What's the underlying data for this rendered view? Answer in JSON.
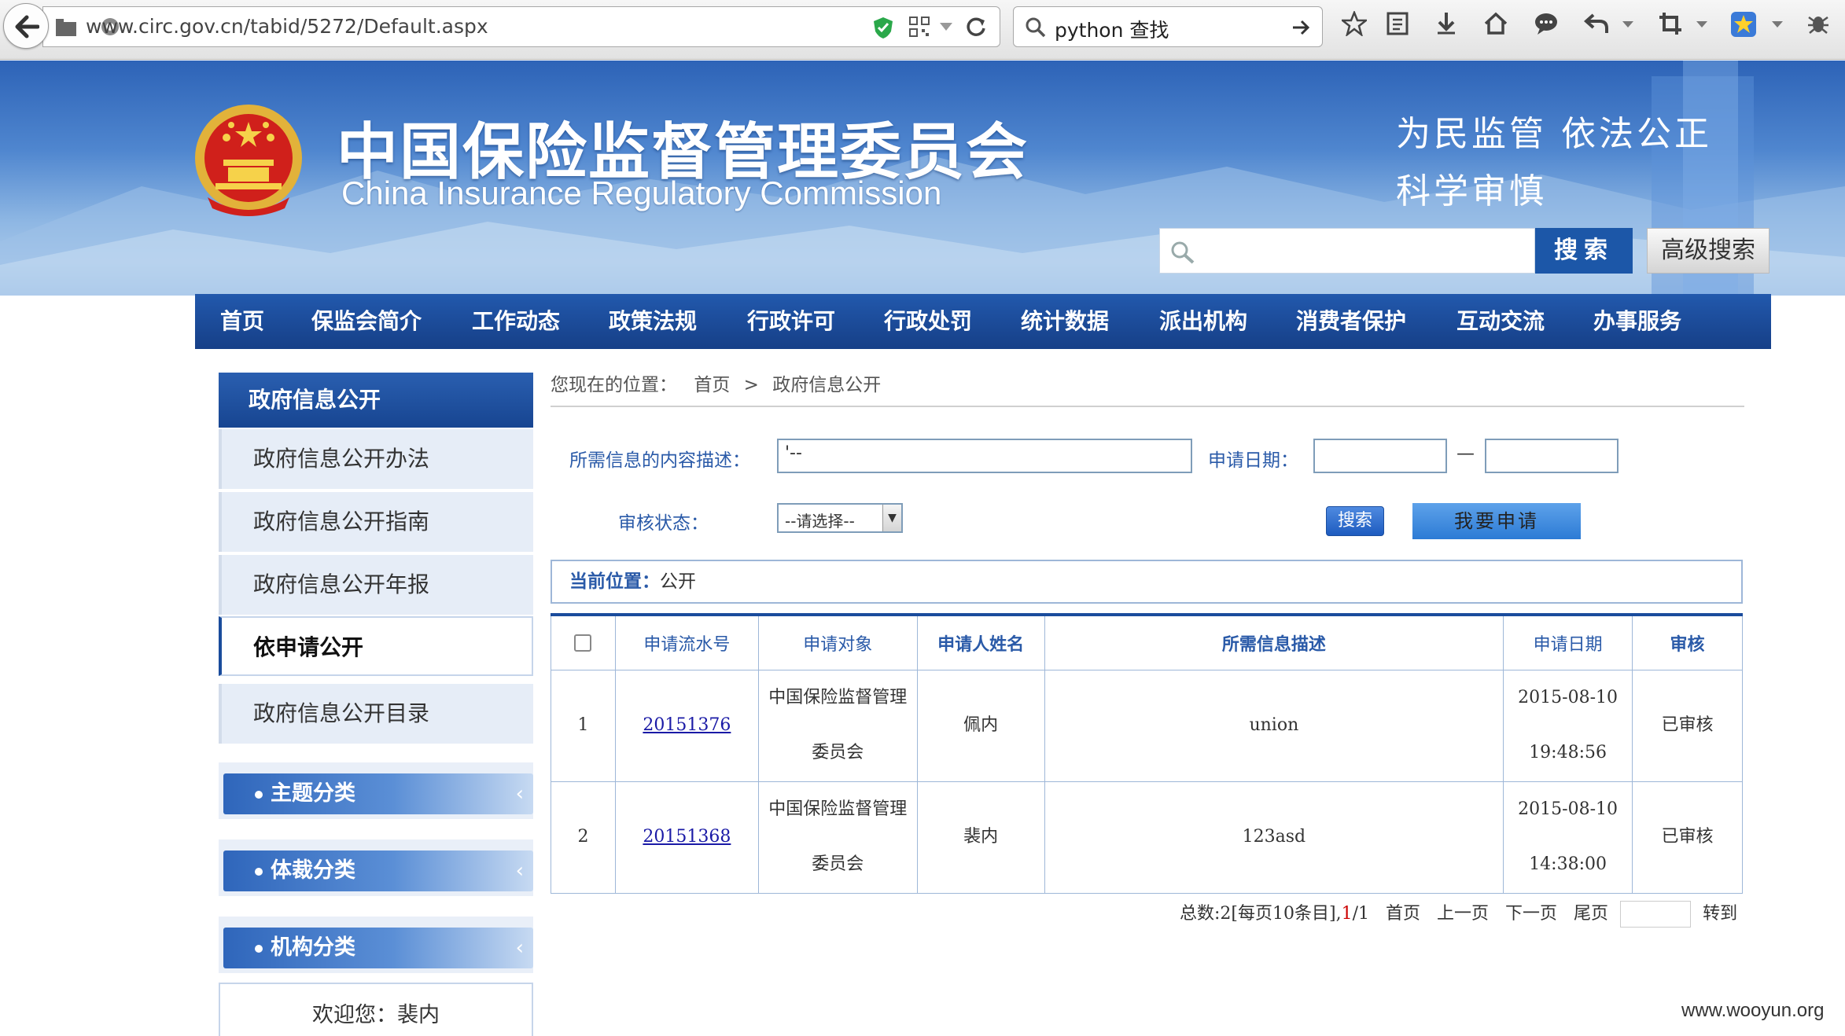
{
  "browser": {
    "url": "www.circ.gov.cn/tabid/5272/Default.aspx",
    "search_query": "python 查找"
  },
  "header": {
    "title": "中国保险监督管理委员会",
    "subtitle": "China Insurance Regulatory Commission",
    "slogan_line1": "为民监管   依法公正",
    "slogan_line2": "科学审慎",
    "search_button": "搜索",
    "advanced_search_button": "高级搜索"
  },
  "nav": {
    "items": [
      "首页",
      "保监会简介",
      "工作动态",
      "政策法规",
      "行政许可",
      "行政处罚",
      "统计数据",
      "派出机构",
      "消费者保护",
      "互动交流",
      "办事服务"
    ]
  },
  "sidebar": {
    "heading": "政府信息公开",
    "items": [
      "政府信息公开办法",
      "政府信息公开指南",
      "政府信息公开年报",
      "依申请公开",
      "政府信息公开目录"
    ],
    "active_index": 3,
    "categories": [
      "主题分类",
      "体裁分类",
      "机构分类"
    ],
    "welcome": "欢迎您：裴内"
  },
  "breadcrumb": {
    "prefix": "您现在的位置：",
    "home": "首页",
    "separator": ">",
    "current": "政府信息公开"
  },
  "form": {
    "desc_label": "所需信息的内容描述：",
    "desc_value": "'--",
    "date_label": "申请日期：",
    "date_sep": "—",
    "status_label": "审核状态：",
    "status_value": "--请选择--",
    "search_button": "搜索",
    "apply_button": "我要申请"
  },
  "current_position": {
    "label": "当前位置：",
    "value": "公开"
  },
  "table": {
    "headers": [
      "申请流水号",
      "申请对象",
      "申请人姓名",
      "所需信息描述",
      "申请日期",
      "审核"
    ],
    "rows": [
      {
        "no": "1",
        "serial": "20151376",
        "target_line1": "中国保险监督管理",
        "target_line2": "委员会",
        "name": "佩内",
        "desc": "union",
        "date": "2015-08-10",
        "time": "19:48:56",
        "status": "已审核"
      },
      {
        "no": "2",
        "serial": "20151368",
        "target_line1": "中国保险监督管理",
        "target_line2": "委员会",
        "name": "裴内",
        "desc": "123asd",
        "date": "2015-08-10",
        "time": "14:38:00",
        "status": "已审核"
      }
    ]
  },
  "pager": {
    "summary": "总数:2[每页10条目],",
    "current_page": "1",
    "total_pages": "/1",
    "first": "首页",
    "prev": "上一页",
    "next": "下一页",
    "last": "尾页",
    "goto": "转到"
  },
  "watermark": "www.wooyun.org"
}
